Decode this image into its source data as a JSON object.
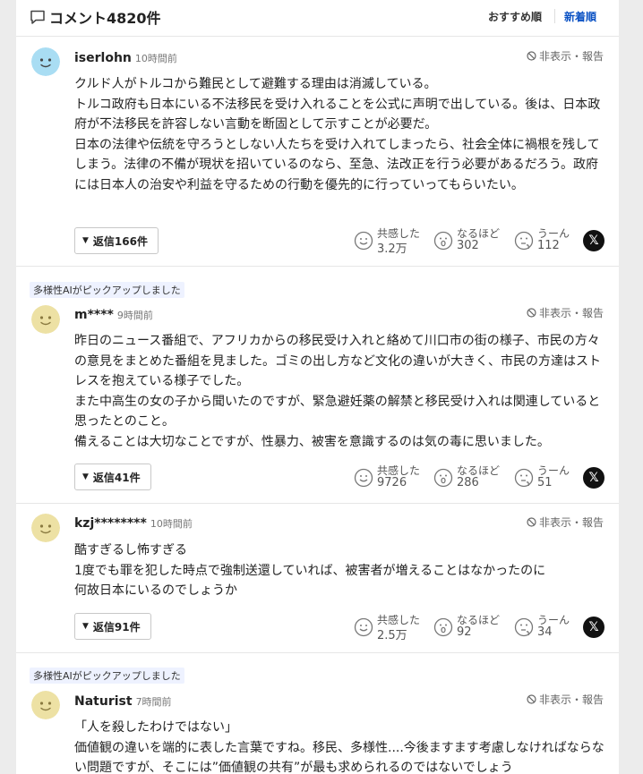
{
  "header": {
    "title": "コメント4820件",
    "sort_recommended": "おすすめ順",
    "sort_new": "新着順"
  },
  "labels": {
    "hide_report": "非表示・報告",
    "reply_prefix": "返信",
    "reaction_agree": "共感した",
    "reaction_naruhodo": "なるほど",
    "reaction_uun": "うーん",
    "x_share": "𝕏"
  },
  "colors": {
    "accent": "#0b52c4",
    "avatar_blue": "#a9ddf3",
    "avatar_yellow": "#ede1a4"
  },
  "comments": [
    {
      "user": "iserlohn",
      "time": "10時間前",
      "avatar": "blue",
      "text": "クルド人がトルコから難民として避難する理由は消滅している。\nトルコ政府も日本にいる不法移民を受け入れることを公式に声明で出している。後は、日本政府が不法移民を許容しない言動を断固として示すことが必要だ。\n日本の法律や伝統を守ろうとしない人たちを受け入れてしまったら、社会全体に禍根を残してしまう。法律の不備が現状を招いているのなら、至急、法改正を行う必要があるだろう。政府には日本人の治安や利益を守るための行動を優先的に行っていってもらいたい。",
      "replies": "返信166件",
      "agree": "3.2万",
      "naruhodo": "302",
      "uun": "112"
    },
    {
      "pick": "多様性AIがピックアップしました",
      "user": "m****",
      "time": "9時間前",
      "avatar": "yellow",
      "text": "昨日のニュース番組で、アフリカからの移民受け入れと絡めて川口市の街の様子、市民の方々の意見をまとめた番組を見ました。ゴミの出し方など文化の違いが大きく、市民の方達はストレスを抱えている様子でした。\nまた中高生の女の子から聞いたのですが、緊急避妊薬の解禁と移民受け入れは関連していると思ったとのこと。\n備えることは大切なことですが、性暴力、被害を意識するのは気の毒に思いました。",
      "replies": "返信41件",
      "agree": "9726",
      "naruhodo": "286",
      "uun": "51"
    },
    {
      "user": "kzj********",
      "time": "10時間前",
      "avatar": "yellow",
      "text": "酷すぎるし怖すぎる\n1度でも罪を犯した時点で強制送還していれば、被害者が増えることはなかったのに\n何故日本にいるのでしょうか",
      "replies": "返信91件",
      "agree": "2.5万",
      "naruhodo": "92",
      "uun": "34"
    },
    {
      "pick": "多様性AIがピックアップしました",
      "user": "Naturist",
      "time": "7時間前",
      "avatar": "yellow",
      "text": "「人を殺したわけではない」\n価値観の違いを端的に表した言葉ですね。移民、多様性....今後ますます考慮しなければならない問題ですが、そこには”価値観の共有”が最も求められるのではないでしょう"
    }
  ]
}
